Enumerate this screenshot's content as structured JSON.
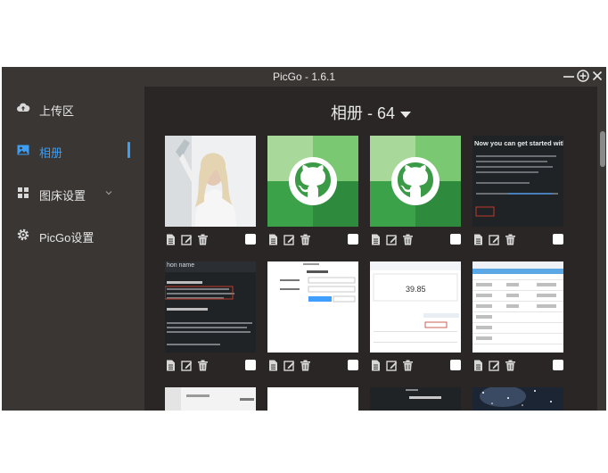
{
  "window": {
    "title": "PicGo - 1.6.1",
    "controls": [
      "minimize-icon",
      "maximize-icon",
      "close-icon"
    ]
  },
  "sidebar": {
    "items": [
      {
        "label": "上传区",
        "icon": "upload-cloud-icon",
        "active": false
      },
      {
        "label": "相册",
        "icon": "image-icon",
        "active": true
      },
      {
        "label": "图床设置",
        "icon": "grid-icon",
        "active": false,
        "expandable": true
      },
      {
        "label": "PicGo设置",
        "icon": "gear-icon",
        "active": false
      }
    ]
  },
  "gallery": {
    "title": "相册 - 64",
    "cards": [
      {
        "kind": "photo-woman"
      },
      {
        "kind": "github-logo"
      },
      {
        "kind": "github-logo"
      },
      {
        "kind": "doc-dark-1",
        "text": "Now you can get started with the"
      },
      {
        "kind": "doc-dark-2",
        "text": "hon name"
      },
      {
        "kind": "form-light"
      },
      {
        "kind": "dashboard-light",
        "text": "39.85"
      },
      {
        "kind": "table-light"
      },
      {
        "kind": "partial-light"
      },
      {
        "kind": "partial-white"
      },
      {
        "kind": "partial-dark-text"
      },
      {
        "kind": "partial-starry"
      }
    ]
  },
  "colors": {
    "window_bg": "#3a3634",
    "content_bg": "#2a2625",
    "accent": "#3a9ff5",
    "github_green_dark": "#2e8b3e",
    "github_green_light": "#7bc872"
  }
}
